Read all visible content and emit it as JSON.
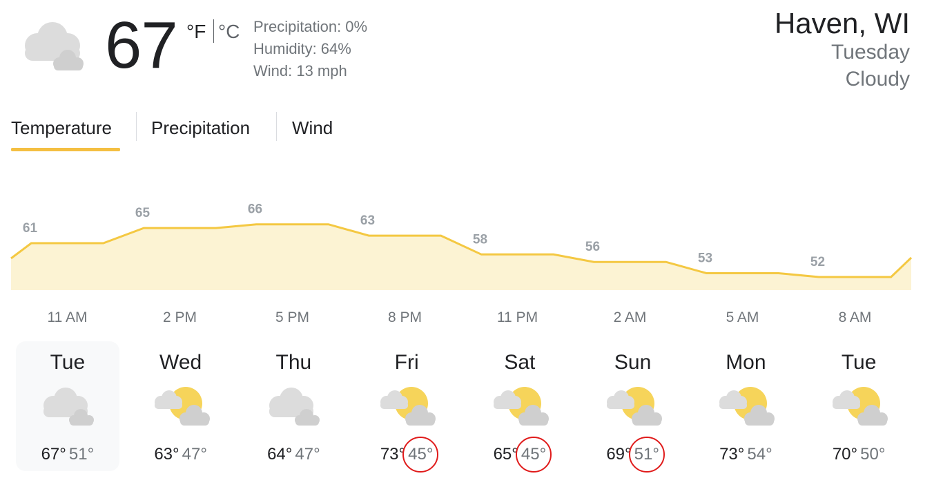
{
  "current": {
    "temperature": "67",
    "unit_f": "°F",
    "unit_c": "°C",
    "icon": "cloudy-icon",
    "precipitation": "Precipitation: 0%",
    "humidity": "Humidity: 64%",
    "wind": "Wind: 13 mph"
  },
  "location": {
    "name": "Haven, WI",
    "day": "Tuesday",
    "condition": "Cloudy"
  },
  "tabs": [
    {
      "label": "Temperature",
      "selected": true
    },
    {
      "label": "Precipitation",
      "selected": false
    },
    {
      "label": "Wind",
      "selected": false
    }
  ],
  "colors": {
    "accent": "#f4bf42",
    "chart_fill": "#fcf3d3",
    "chart_line": "#f4c842",
    "label_gray": "#9aa0a6",
    "circle_red": "#e01b1b"
  },
  "chart_data": {
    "type": "area",
    "x": [
      "11 AM",
      "2 PM",
      "5 PM",
      "8 PM",
      "11 PM",
      "2 AM",
      "5 AM",
      "8 AM"
    ],
    "values": [
      61,
      65,
      66,
      63,
      58,
      56,
      53,
      52
    ],
    "title": "",
    "xlabel": "",
    "ylabel": "",
    "grid": false
  },
  "days": [
    {
      "name": "Tue",
      "icon": "cloudy-icon",
      "high": "67°",
      "low": "51°",
      "selected": true,
      "circled": false
    },
    {
      "name": "Wed",
      "icon": "partly-cloudy-icon",
      "high": "63°",
      "low": "47°",
      "selected": false,
      "circled": false
    },
    {
      "name": "Thu",
      "icon": "cloudy-icon",
      "high": "64°",
      "low": "47°",
      "selected": false,
      "circled": false
    },
    {
      "name": "Fri",
      "icon": "partly-cloudy-icon",
      "high": "73°",
      "low": "45°",
      "selected": false,
      "circled": true
    },
    {
      "name": "Sat",
      "icon": "partly-cloudy-icon",
      "high": "65°",
      "low": "45°",
      "selected": false,
      "circled": true
    },
    {
      "name": "Sun",
      "icon": "partly-cloudy-icon",
      "high": "69°",
      "low": "51°",
      "selected": false,
      "circled": true
    },
    {
      "name": "Mon",
      "icon": "partly-cloudy-icon",
      "high": "73°",
      "low": "54°",
      "selected": false,
      "circled": false
    },
    {
      "name": "Tue",
      "icon": "partly-cloudy-icon",
      "high": "70°",
      "low": "50°",
      "selected": false,
      "circled": false
    }
  ]
}
